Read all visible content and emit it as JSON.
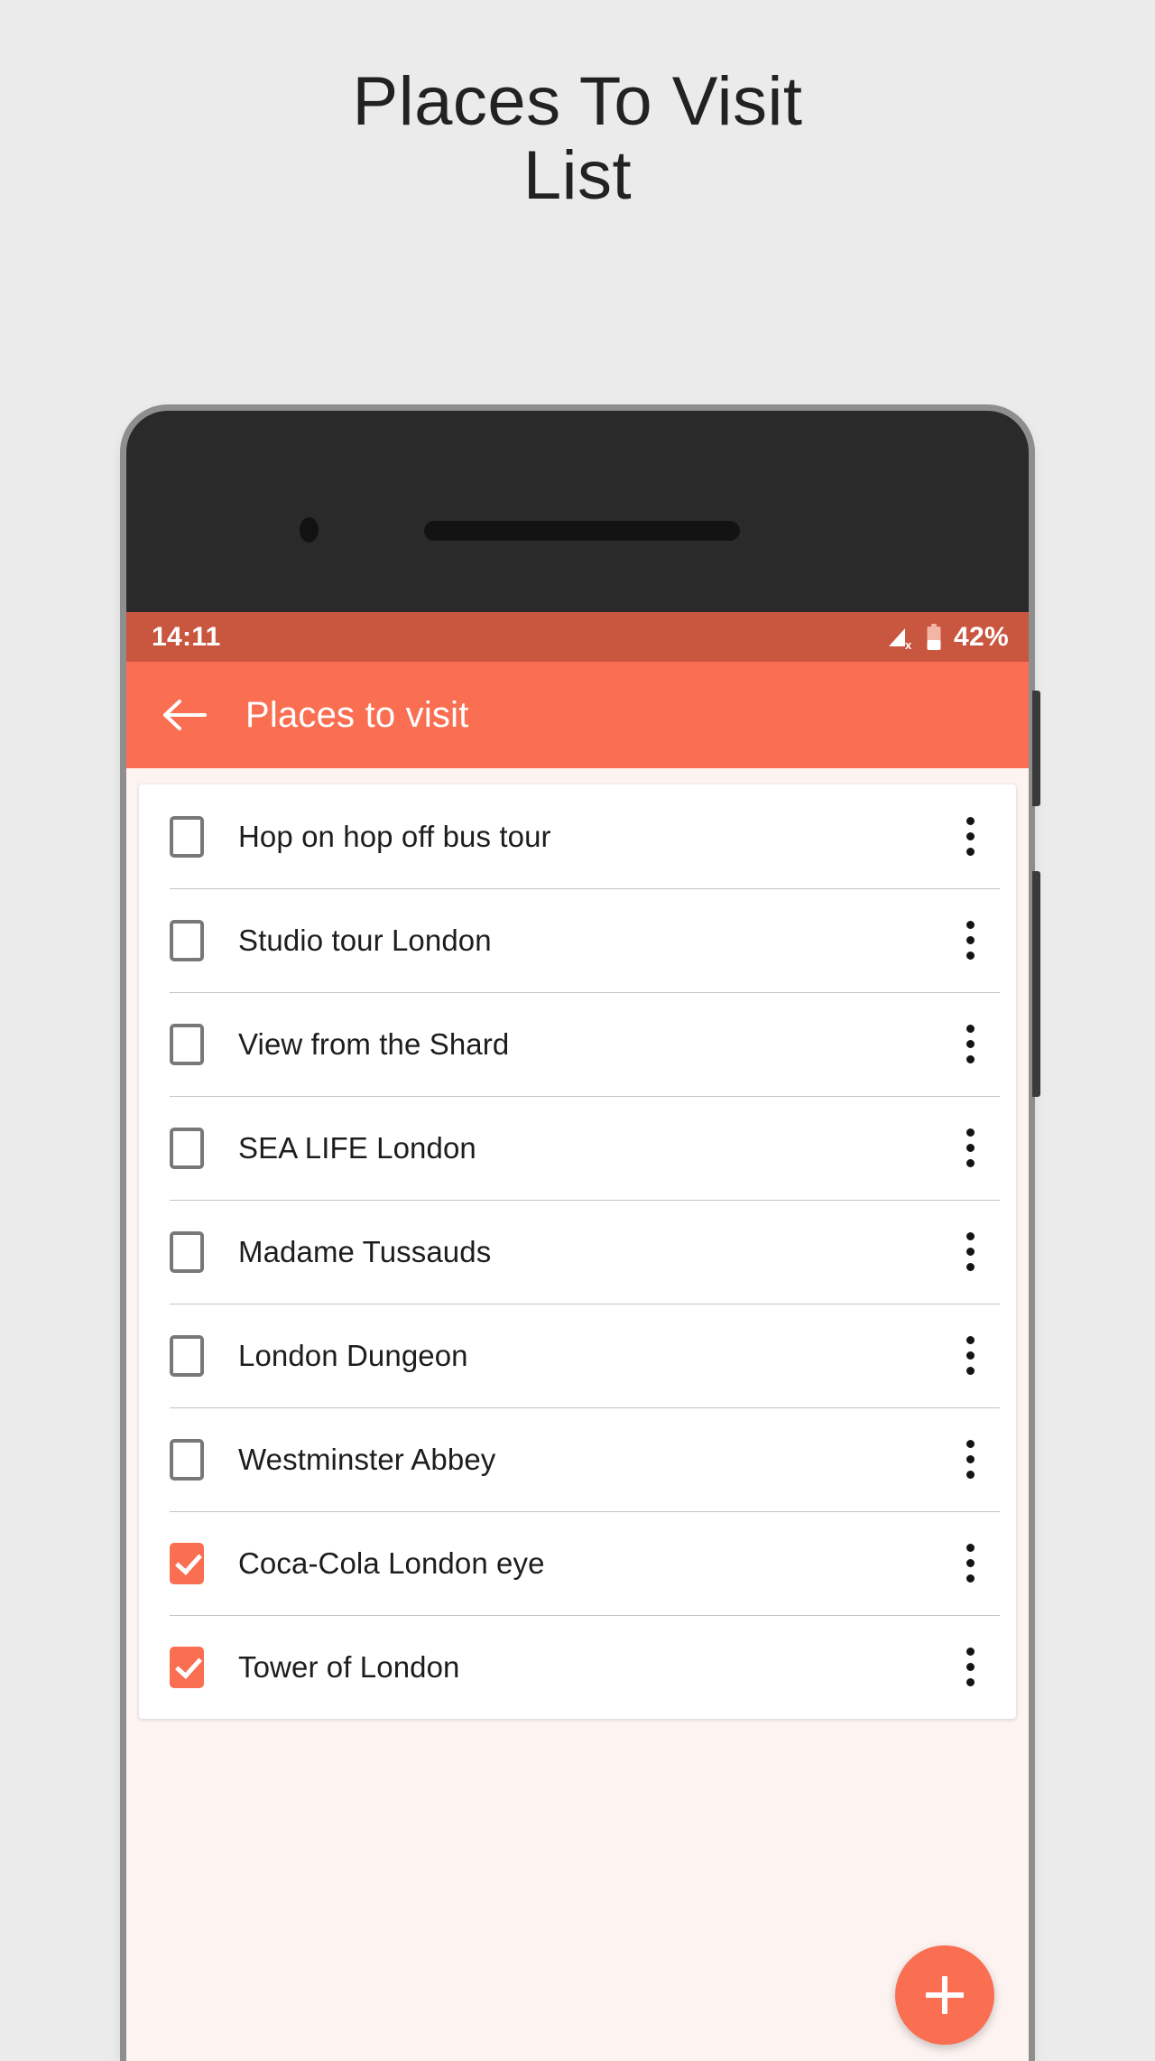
{
  "heading": "Places To Visit\nList",
  "phone": {
    "camera_icon": "camera-icon",
    "speaker_icon": "speaker-grill-icon",
    "side_button_upper": "volume-button",
    "side_button_lower": "power-button"
  },
  "status_bar": {
    "time": "14:11",
    "battery_percent": "42%",
    "signal_icon": "signal-no-service-icon",
    "battery_icon": "battery-icon",
    "battery_level": 42,
    "background_color": "#C9563F",
    "text_color": "#FFFFFF"
  },
  "app_bar": {
    "back_icon": "back-arrow-icon",
    "title": "Places to visit",
    "background_color": "#FA6E52",
    "text_color": "#FFFFFF"
  },
  "list": {
    "items": [
      {
        "label": "Hop on hop off bus tour",
        "checked": false
      },
      {
        "label": "Studio tour London",
        "checked": false
      },
      {
        "label": "View from the Shard",
        "checked": false
      },
      {
        "label": "SEA LIFE London",
        "checked": false
      },
      {
        "label": "Madame Tussauds",
        "checked": false
      },
      {
        "label": "London Dungeon",
        "checked": false
      },
      {
        "label": "Westminster Abbey",
        "checked": false
      },
      {
        "label": "Coca-Cola London eye",
        "checked": true
      },
      {
        "label": "Tower of London",
        "checked": true
      }
    ],
    "overflow_icon": "more-vertical-icon",
    "checkbox_checked_color": "#FA6E52",
    "checkbox_unchecked_color": "#787878"
  },
  "fab": {
    "icon": "plus-icon",
    "label": "+",
    "color": "#FA6E52"
  },
  "colors": {
    "page_background": "#EBEBEB",
    "screen_background": "#FDF4F2",
    "card_background": "#FFFFFF",
    "accent": "#FA6E52",
    "status_bar": "#C9563F"
  }
}
